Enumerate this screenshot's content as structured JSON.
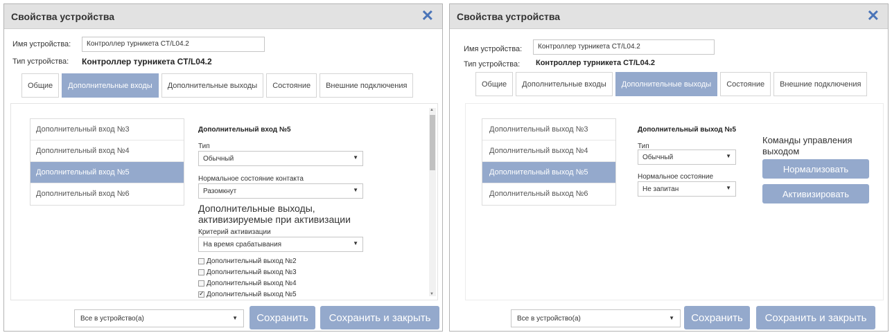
{
  "left": {
    "title": "Свойства устройства",
    "name_label": "Имя устройства:",
    "name_value": "Контроллер турникета CT/L04.2",
    "type_label": "Тип устройства:",
    "type_value": "Контроллер турникета CT/L04.2",
    "tabs": [
      "Общие",
      "Дополнительные входы",
      "Дополнительные выходы",
      "Состояние",
      "Внешние подключения"
    ],
    "active_tab": 1,
    "list": [
      "Дополнительный вход №3",
      "Дополнительный вход №4",
      "Дополнительный вход №5",
      "Дополнительный вход №6"
    ],
    "active_item": 2,
    "detail_title": "Дополнительный вход №5",
    "type_field_label": "Тип",
    "type_field_value": "Обычный",
    "normal_label": "Нормальное состояние контакта",
    "normal_value": "Разомкнут",
    "outputs_heading_line1": "Дополнительные выходы,",
    "outputs_heading_line2": "активизируемые при активизации",
    "criterion_label": "Критерий активизации",
    "criterion_value": "На время срабатывания",
    "checkboxes": [
      {
        "label": "Дополнительный выход №2",
        "checked": false
      },
      {
        "label": "Дополнительный выход №3",
        "checked": false
      },
      {
        "label": "Дополнительный выход №4",
        "checked": false
      },
      {
        "label": "Дополнительный выход №5",
        "checked": true
      }
    ],
    "footer_select": "Все в устройство(а)",
    "save_label": "Сохранить",
    "save_close_label": "Сохранить и закрыть"
  },
  "right": {
    "title": "Свойства устройства",
    "name_label": "Имя устройства:",
    "name_value": "Контроллер турникета CT/L04.2",
    "type_label": "Тип устройства:",
    "type_value": "Контроллер турникета CT/L04.2",
    "tabs": [
      "Общие",
      "Дополнительные входы",
      "Дополнительные выходы",
      "Состояние",
      "Внешние подключения"
    ],
    "active_tab": 2,
    "list": [
      "Дополнительный выход №3",
      "Дополнительный выход №4",
      "Дополнительный выход №5",
      "Дополнительный выход №6"
    ],
    "active_item": 2,
    "detail_title": "Дополнительный выход №5",
    "type_field_label": "Тип",
    "type_field_value": "Обычный",
    "normal_label": "Нормальное состояние",
    "normal_value": "Не запитан",
    "commands_line1": "Команды управления",
    "commands_line2": "выходом",
    "normalize_label": "Нормализовать",
    "activate_label": "Активизировать",
    "footer_select": "Все в устройство(а)",
    "save_label": "Сохранить",
    "save_close_label": "Сохранить и закрыть"
  },
  "icons": {
    "close": "close-icon",
    "dropdown": "chevron-down-icon",
    "scroll_up": "scroll-up-icon",
    "scroll_down": "scroll-down-icon"
  },
  "colors": {
    "accent": "#94a9cc",
    "close": "#4a74b8",
    "titlebar": "#e2e2e2"
  }
}
